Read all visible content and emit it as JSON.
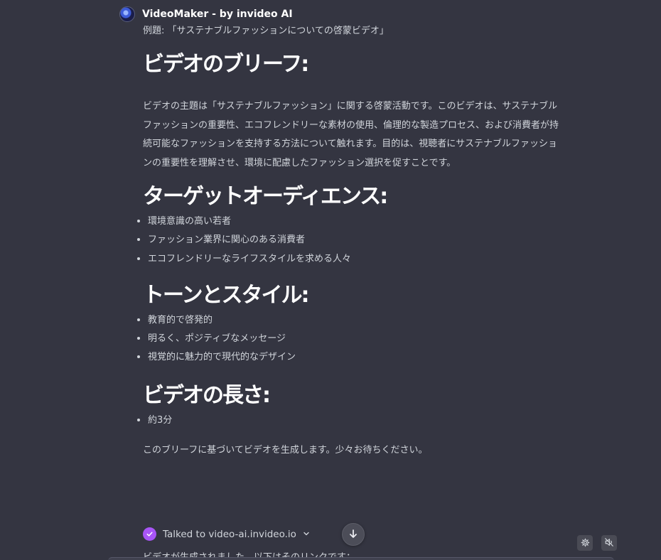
{
  "bot": {
    "name": "VideoMaker - by invideo AI",
    "avatar_icon": "videomaker-logo-icon"
  },
  "message": {
    "example": "例題: 「サステナブルファッションについての啓蒙ビデオ」",
    "brief": {
      "heading": "ビデオのブリーフ:",
      "paragraph": "ビデオの主題は「サステナブルファッション」に関する啓蒙活動です。このビデオは、サステナブルファッションの重要性、エコフレンドリーな素材の使用、倫理的な製造プロセス、および消費者が持続可能なファッションを支持する方法について触れます。目的は、視聴者にサステナブルファッションの重要性を理解させ、環境に配慮したファッション選択を促すことです。"
    },
    "target": {
      "heading": "ターゲットオーディエンス:",
      "items": [
        "環境意識の高い若者",
        "ファッション業界に関心のある消費者",
        "エコフレンドリーなライフスタイルを求める人々"
      ]
    },
    "tone": {
      "heading": "トーンとスタイル:",
      "items": [
        "教育的で啓発的",
        "明るく、ポジティブなメッセージ",
        "視覚的に魅力的で現代的なデザイン"
      ]
    },
    "length": {
      "heading": "ビデオの長さ:",
      "items": [
        "約3分"
      ]
    },
    "closing": "このブリーフに基づいてビデオを生成します。少々お待ちください。",
    "plugin": {
      "label": "Talked to video-ai.invideo.io",
      "icon": "check-circle-icon",
      "chevron": "chevron-down-icon"
    },
    "cut_off_text": "ビデオが生成されました。以下はそのリンクです："
  },
  "controls": {
    "scroll_down_icon": "arrow-down-icon",
    "settings_icon": "gear-icon",
    "mute_icon": "speaker-muted-icon"
  },
  "colors": {
    "background": "#343541",
    "text": "#d1d5db",
    "heading": "#ffffff",
    "plugin_check": "#a855f7",
    "button_bg": "#4c4d58"
  }
}
